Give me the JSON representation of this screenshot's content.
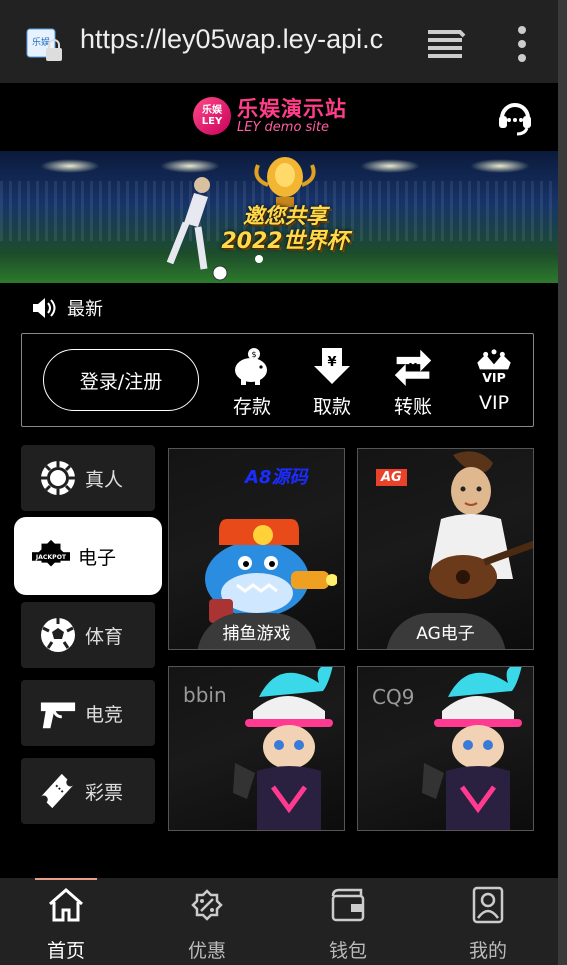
{
  "browser": {
    "url": "https://ley05wap.ley-api.c",
    "favicon_text": "乐娱"
  },
  "header": {
    "logo_badge": "乐娱\nLEY",
    "logo_cn": "乐娱演示站",
    "logo_en": "LEY demo site",
    "support_icon": "headset-icon"
  },
  "banner": {
    "line1": "邀您共享",
    "line2": "2022世界杯"
  },
  "marquee": {
    "icon": "speaker-icon",
    "label": "最新"
  },
  "actions": {
    "login_label": "登录/注册",
    "items": [
      {
        "label": "存款",
        "icon": "piggy-bank-icon"
      },
      {
        "label": "取款",
        "icon": "withdraw-icon"
      },
      {
        "label": "转账",
        "icon": "transfer-icon"
      },
      {
        "label": "VIP",
        "icon": "crown-icon"
      }
    ]
  },
  "sidebar": {
    "items": [
      {
        "label": "真人",
        "icon": "casino-chip-icon",
        "active": false
      },
      {
        "label": "电子",
        "icon": "jackpot-icon",
        "active": true,
        "badge": "JACKPOT"
      },
      {
        "label": "体育",
        "icon": "soccer-ball-icon",
        "active": false
      },
      {
        "label": "电竞",
        "icon": "gun-icon",
        "active": false
      },
      {
        "label": "彩票",
        "icon": "ticket-icon",
        "active": false
      }
    ]
  },
  "games": [
    {
      "brand": "A8源码",
      "caption": "捕鱼游戏",
      "brand_color": "#1a2cff"
    },
    {
      "brand": "AG",
      "caption": "AG电子",
      "brand_color": "#e8432a"
    },
    {
      "brand": "bbin",
      "caption": "",
      "brand_color": "#9a9a9a"
    },
    {
      "brand": "CQ9",
      "caption": "",
      "brand_color": "#9a9a9a"
    }
  ],
  "bottom_nav": {
    "items": [
      {
        "label": "首页",
        "icon": "home-icon",
        "active": true
      },
      {
        "label": "优惠",
        "icon": "discount-icon",
        "active": false
      },
      {
        "label": "钱包",
        "icon": "wallet-icon",
        "active": false
      },
      {
        "label": "我的",
        "icon": "profile-icon",
        "active": false
      }
    ]
  },
  "colors": {
    "brand_pink": "#ff3d88",
    "active_underline": "#e8a08a",
    "nav_bg": "#222222"
  }
}
